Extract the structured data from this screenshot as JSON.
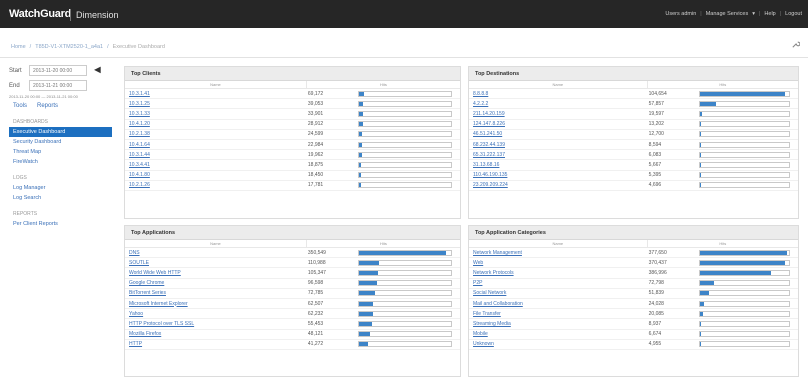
{
  "header": {
    "brand": "WatchGuard",
    "app_name": "Dimension",
    "nav": [
      "Users admin",
      "Manage Services",
      "Help",
      "Logout"
    ]
  },
  "breadcrumbs": [
    "Home",
    "T85D-V1-XTM2520-1_a4a1",
    "Executive Dashboard"
  ],
  "sidebar": {
    "start_label": "Start",
    "start_value": "2013-11-20 00:00",
    "end_label": "End",
    "end_value": "2013-11-21 00:00",
    "range_text": "2013-11-20 00:00 — 2013-11-21 00:00",
    "tools_label": "Tools",
    "reports_label": "Reports",
    "sections": [
      {
        "title": "DASHBOARDS",
        "items": [
          "Executive Dashboard",
          "Security Dashboard",
          "Threat Map",
          "FireWatch"
        ]
      },
      {
        "title": "LOGS",
        "items": [
          "Log Manager",
          "Log Search"
        ]
      },
      {
        "title": "REPORTS",
        "items": [
          "Per Client Reports"
        ]
      }
    ]
  },
  "panels": {
    "col_name": "Name",
    "col_hits": "Hits",
    "top_clients": {
      "title": "Top Clients",
      "rows": [
        {
          "name": "10.3.1.41",
          "count": "69,172",
          "pct": 0.06
        },
        {
          "name": "10.3.1.25",
          "count": "39,053",
          "pct": 0.05
        },
        {
          "name": "10.3.1.33",
          "count": "33,901",
          "pct": 0.05
        },
        {
          "name": "10.4.1.20",
          "count": "28,912",
          "pct": 0.04
        },
        {
          "name": "10.2.1.38",
          "count": "24,599",
          "pct": 0.03
        },
        {
          "name": "10.4.1.64",
          "count": "22,984",
          "pct": 0.03
        },
        {
          "name": "10.3.1.44",
          "count": "19,962",
          "pct": 0.03
        },
        {
          "name": "10.3.4.41",
          "count": "18,875",
          "pct": 0.02
        },
        {
          "name": "10.4.1.80",
          "count": "18,450",
          "pct": 0.02
        },
        {
          "name": "10.2.1.26",
          "count": "17,781",
          "pct": 0.02
        }
      ]
    },
    "top_destinations": {
      "title": "Top Destinations",
      "rows": [
        {
          "name": "8.8.8.8",
          "count": "104,654",
          "pct": 0.96
        },
        {
          "name": "4.2.2.2",
          "count": "57,857",
          "pct": 0.18
        },
        {
          "name": "211.14.20.159",
          "count": "19,597",
          "pct": 0.03
        },
        {
          "name": "124.147.8.226",
          "count": "13,202",
          "pct": 0.02
        },
        {
          "name": "46.51.241.50",
          "count": "12,700",
          "pct": 0.02
        },
        {
          "name": "68.232.44.139",
          "count": "8,594",
          "pct": 0.01
        },
        {
          "name": "65.31.222.137",
          "count": "6,083",
          "pct": 0.01
        },
        {
          "name": "31.13.68.16",
          "count": "5,667",
          "pct": 0.01
        },
        {
          "name": "110.46.190.135",
          "count": "5,395",
          "pct": 0.01
        },
        {
          "name": "23.209.209.224",
          "count": "4,696",
          "pct": 0.01
        }
      ]
    },
    "top_applications": {
      "title": "Top Applications",
      "rows": [
        {
          "name": "DNS",
          "count": "350,549",
          "pct": 0.95
        },
        {
          "name": "SOUTLE",
          "count": "110,988",
          "pct": 0.22
        },
        {
          "name": "World Wide Web HTTP",
          "count": "105,347",
          "pct": 0.21
        },
        {
          "name": "Google Chrome",
          "count": "96,598",
          "pct": 0.2
        },
        {
          "name": "BitTorrent Series",
          "count": "72,785",
          "pct": 0.17
        },
        {
          "name": "Microsoft Internet Explorer",
          "count": "62,507",
          "pct": 0.15
        },
        {
          "name": "Yahoo",
          "count": "62,232",
          "pct": 0.15
        },
        {
          "name": "HTTP Protocol over TLS SSL",
          "count": "55,453",
          "pct": 0.14
        },
        {
          "name": "Mozilla Firefox",
          "count": "48,121",
          "pct": 0.12
        },
        {
          "name": "HTTP",
          "count": "41,272",
          "pct": 0.1
        }
      ]
    },
    "top_app_categories": {
      "title": "Top Application Categories",
      "rows": [
        {
          "name": "Network Management",
          "count": "377,650",
          "pct": 0.98
        },
        {
          "name": "Web",
          "count": "370,437",
          "pct": 0.96
        },
        {
          "name": "Network Protocols",
          "count": "386,996",
          "pct": 0.8
        },
        {
          "name": "P2P",
          "count": "72,798",
          "pct": 0.16
        },
        {
          "name": "Social Network",
          "count": "51,839",
          "pct": 0.11
        },
        {
          "name": "Mail and Collaboration",
          "count": "24,028",
          "pct": 0.05
        },
        {
          "name": "File Transfer",
          "count": "20,085",
          "pct": 0.04
        },
        {
          "name": "Streaming Media",
          "count": "8,937",
          "pct": 0.02
        },
        {
          "name": "Mobile",
          "count": "6,674",
          "pct": 0.01
        },
        {
          "name": "Unknown",
          "count": "4,955",
          "pct": 0.01
        }
      ]
    }
  }
}
